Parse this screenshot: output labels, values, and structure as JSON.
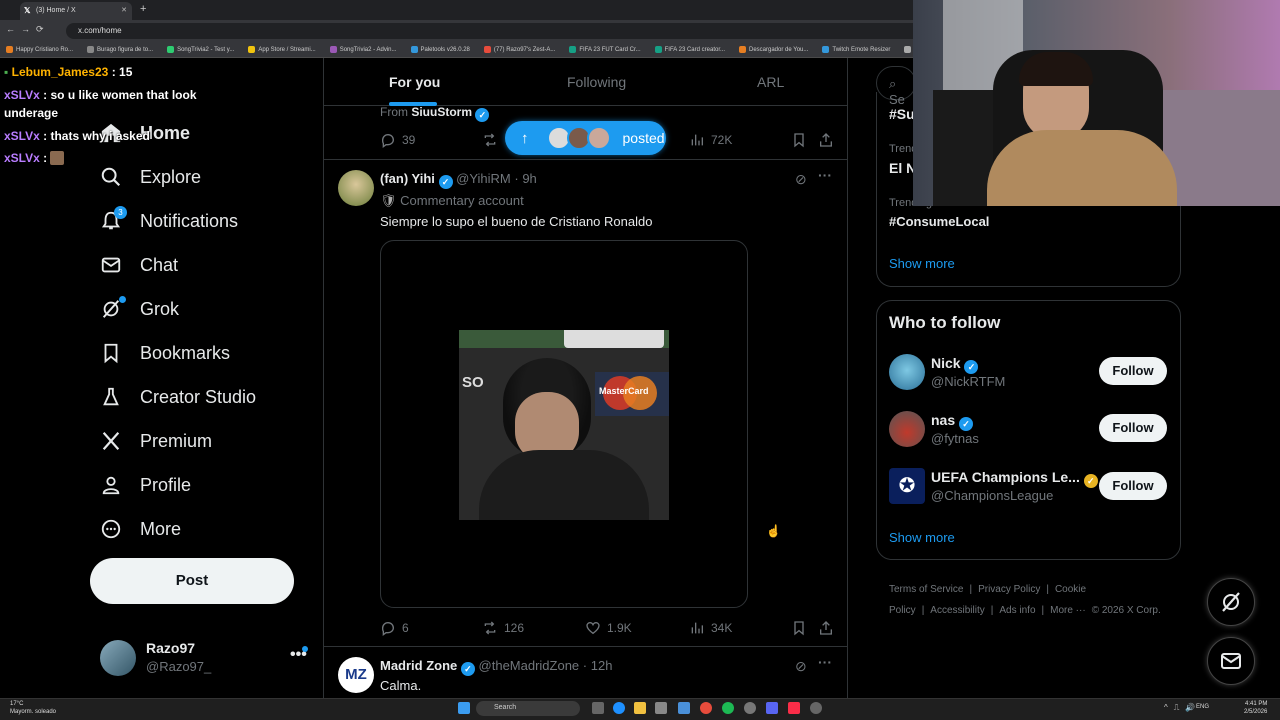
{
  "browser": {
    "tab_title": "(3) Home / X",
    "url": "x.com/home",
    "bookmarks": [
      "Happy Cristiano Ro...",
      "Burago figura de to...",
      "SongTrivia2 - Test y...",
      "App Store / Streami...",
      "SongTrivia2 - Advin...",
      "Paletools v26.0.28",
      "(77) Razo97's Zest-A...",
      "FIFA 23 FUT Card Cr...",
      "FIFA 23 Card creator...",
      "Descargador de You...",
      "Twitch Emote Resizer",
      "twitch emote m..."
    ]
  },
  "chat": [
    {
      "user": "Lebum_James23",
      "sep": ":",
      "msg": "15"
    },
    {
      "user": "xSLVx",
      "sep": ":",
      "msg": "so u like women that look"
    },
    {
      "msg": "underage"
    },
    {
      "user": "xSLVx",
      "sep": ":",
      "msg": "thats why i asked"
    },
    {
      "user": "xSLVx",
      "sep": ":"
    }
  ],
  "nav": {
    "home": "Home",
    "explore": "Explore",
    "notifications": "Notifications",
    "notifications_badge": "3",
    "chat": "Chat",
    "grok": "Grok",
    "bookmarks": "Bookmarks",
    "creator_studio": "Creator Studio",
    "premium": "Premium",
    "profile": "Profile",
    "more": "More",
    "post": "Post"
  },
  "account": {
    "name": "Razo97",
    "handle": "@Razo97_",
    "more": "•••"
  },
  "timeline": {
    "tabs": [
      "For you",
      "Following",
      "ARL"
    ],
    "posted_pill": "posted",
    "prev_post": {
      "from_label": "From",
      "from_name": "SiuuStorm",
      "replies": "39",
      "views": "72K"
    },
    "post1": {
      "name": "(fan) Yihi",
      "handle": "@YihiRM",
      "time": "· 9h",
      "label": "Commentary account",
      "text": "Siempre lo supo el bueno de Cristiano Ronaldo",
      "media_text_left": "SO",
      "media_text_right": "MasterCard",
      "replies": "6",
      "reposts": "126",
      "likes": "1.9K",
      "views": "34K"
    },
    "post2": {
      "name": "Madrid Zone",
      "handle": "@theMadridZone",
      "time": "· 12h",
      "avatar_text": "MZ",
      "text": "Calma."
    }
  },
  "right": {
    "search_placeholder": "Se",
    "trends": [
      {
        "context": "",
        "title": "#Su"
      },
      {
        "context": "Trend",
        "title": "El N"
      },
      {
        "context": "Trending in Mexico",
        "title": "#ConsumeLocal"
      }
    ],
    "trends_show_more": "Show more",
    "who_to_follow_title": "Who to follow",
    "who_to_follow": [
      {
        "name": "Nick",
        "handle": "@NickRTFM",
        "badge": "blue",
        "button": "Follow"
      },
      {
        "name": "nas",
        "handle": "@fytnas",
        "badge": "blue",
        "button": "Follow"
      },
      {
        "name": "UEFA Champions Le...",
        "handle": "@ChampionsLeague",
        "badge": "gold",
        "button": "Follow"
      }
    ],
    "wtf_show_more": "Show more",
    "footer": [
      "Terms of Service",
      "|",
      "Privacy Policy",
      "|",
      "Cookie Policy",
      "|",
      "Accessibility",
      "|",
      "Ads info",
      "|",
      "More ···",
      "© 2026 X Corp."
    ]
  },
  "taskbar": {
    "weather_temp": "17°C",
    "weather_desc": "Mayorm. soleado",
    "search": "Search",
    "lang": "ENG",
    "time": "4:41 PM",
    "date": "2/5/2026"
  },
  "colors": {
    "accent": "#1d9bf0",
    "background": "#000000",
    "border": "#2f3336",
    "muted": "#71767b"
  }
}
